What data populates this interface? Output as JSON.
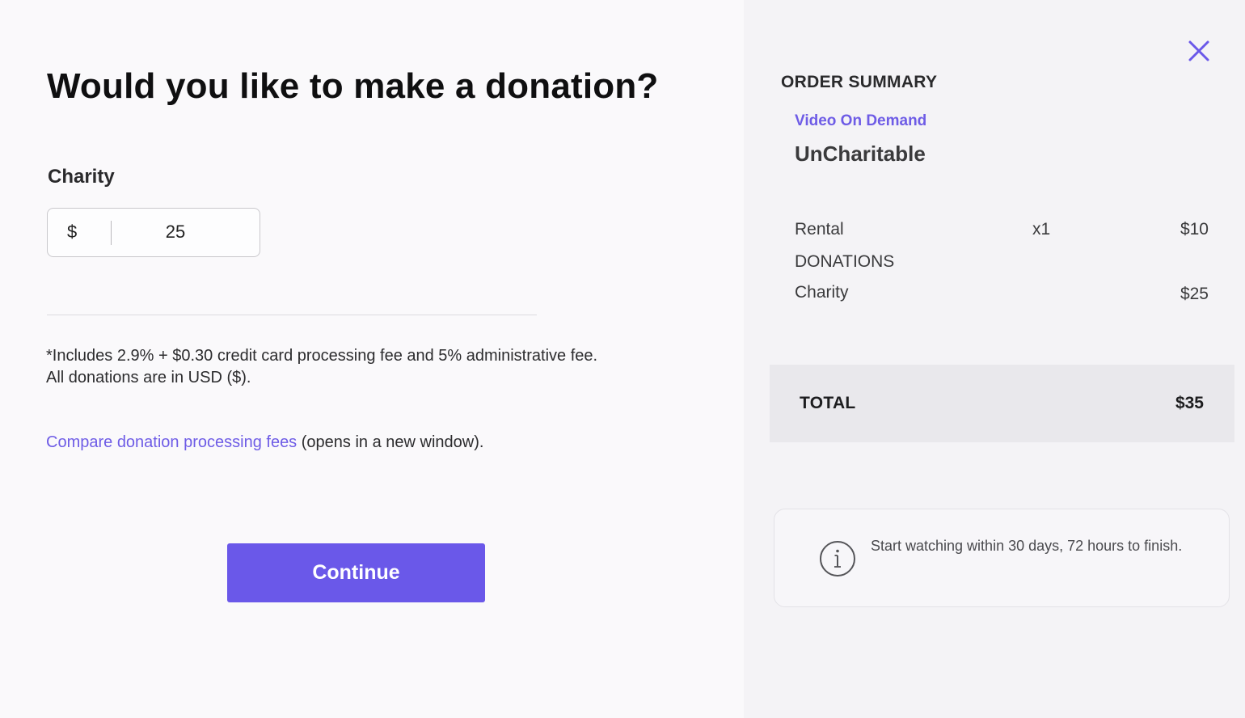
{
  "donation": {
    "heading": "Would you like to make a donation?",
    "field_label": "Charity",
    "currency_symbol": "$",
    "amount_value": "25",
    "fee_note_line1": "*Includes 2.9% + $0.30 credit card processing fee and 5% administrative fee.",
    "fee_note_line2": "All donations are in USD ($).",
    "compare_link_text": "Compare donation processing fees",
    "compare_suffix": " (opens in a new window).",
    "continue_label": "Continue"
  },
  "summary": {
    "close_icon": "close-icon",
    "title": "ORDER SUMMARY",
    "product_type": "Video On Demand",
    "product_name": "UnCharitable",
    "rental_label": "Rental",
    "rental_qty": "x1",
    "rental_price": "$10",
    "donations_header": "DONATIONS",
    "charity_label": "Charity",
    "charity_price": "$25",
    "total_label": "TOTAL",
    "total_value": "$35",
    "info_icon": "info-icon",
    "info_text": "Start watching within 30 days, 72 hours to finish."
  },
  "colors": {
    "accent": "#6a58e9",
    "link": "#6e5ce6",
    "left_background": "#faf9fb",
    "right_background": "#f4f3f6",
    "total_background": "#e9e8ec"
  }
}
